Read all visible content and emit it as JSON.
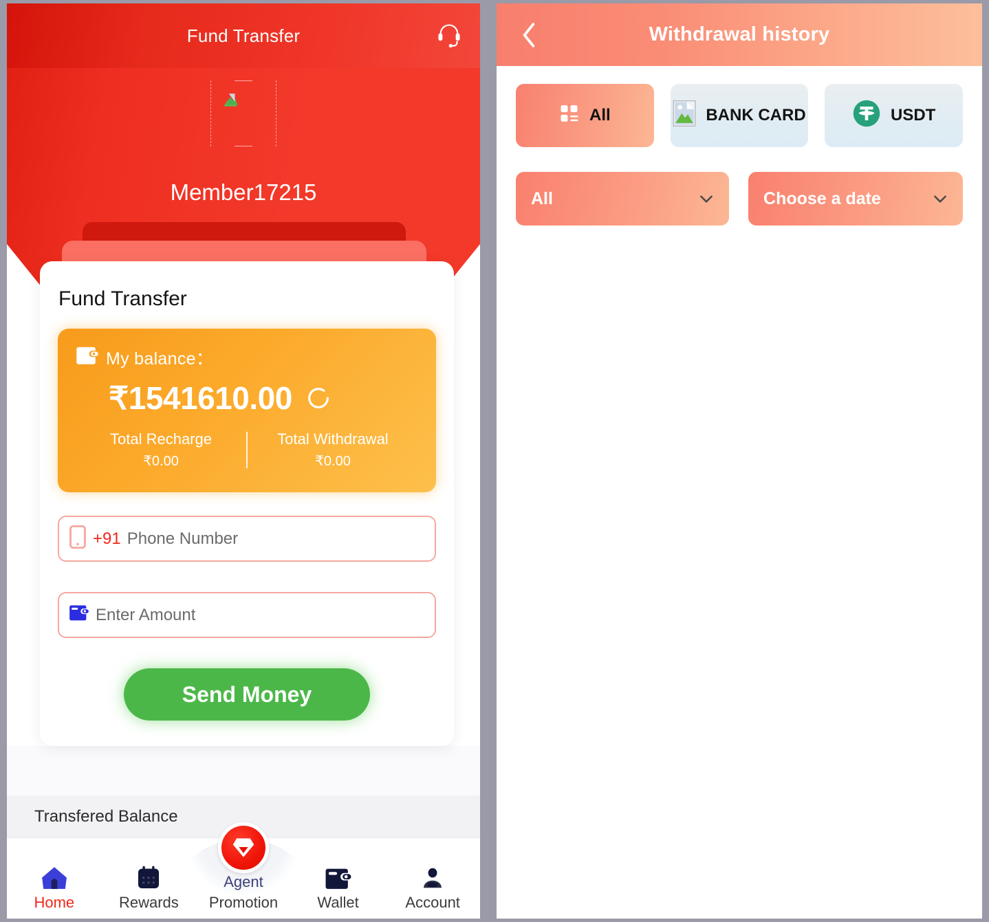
{
  "left_panel": {
    "topbar": {
      "title": "Fund Transfer",
      "support_icon": "headset-icon"
    },
    "profile": {
      "avatar_icon": "broken-image-icon",
      "member_name": "Member17215"
    },
    "card": {
      "title": "Fund Transfer",
      "balance": {
        "wallet_icon": "wallet-icon",
        "label": "My balance：",
        "amount": "₹1541610.00",
        "refresh_icon": "refresh-icon",
        "total_recharge_label": "Total Recharge",
        "total_recharge_value": "₹0.00",
        "total_withdrawal_label": "Total Withdrawal",
        "total_withdrawal_value": "₹0.00"
      },
      "phone_field": {
        "icon": "mobile-phone-icon",
        "country_code": "+91",
        "placeholder": "Phone Number",
        "value": ""
      },
      "amount_field": {
        "icon": "wallet-icon",
        "placeholder": "Enter Amount",
        "value": ""
      },
      "submit_label": "Send Money"
    },
    "transfered_balance_label": "Transfered Balance",
    "bottom_nav": {
      "promotion_badge_icon": "diamond-chevron-icon",
      "items": [
        {
          "label": "Home",
          "icon": "home-icon",
          "active": true
        },
        {
          "label": "Rewards",
          "icon": "calendar-icon",
          "active": false
        },
        {
          "label": "Promotion",
          "icon": "agent-icon",
          "active": false,
          "behind_text": "Agent"
        },
        {
          "label": "Wallet",
          "icon": "wallet-icon",
          "active": false
        },
        {
          "label": "Account",
          "icon": "person-icon",
          "active": false
        }
      ]
    }
  },
  "right_panel": {
    "header": {
      "back_icon": "chevron-left-icon",
      "title": "Withdrawal history"
    },
    "chips": [
      {
        "label": "All",
        "icon": "grid-dashboard-icon",
        "active": true
      },
      {
        "label": "BANK CARD",
        "icon": "broken-image-icon",
        "active": false
      },
      {
        "label": "USDT",
        "icon": "tether-usdt-icon",
        "active": false
      }
    ],
    "filters": [
      {
        "name": "status-select",
        "value": "All",
        "chevron_icon": "chevron-down-icon"
      },
      {
        "name": "date-select",
        "value": "Choose a date",
        "chevron_icon": "chevron-down-icon"
      }
    ],
    "list_items": []
  },
  "colors": {
    "brand_red": "#F0281B",
    "header_red_dark": "#D4140A",
    "balance_orange": "#FCA92A",
    "send_green": "#4CB749",
    "coral": "#F8806E",
    "peach": "#FCBF9C",
    "tether_green": "#26A17B",
    "nav_blue": "#3B3FD8",
    "nav_dark": "#1C2247"
  }
}
